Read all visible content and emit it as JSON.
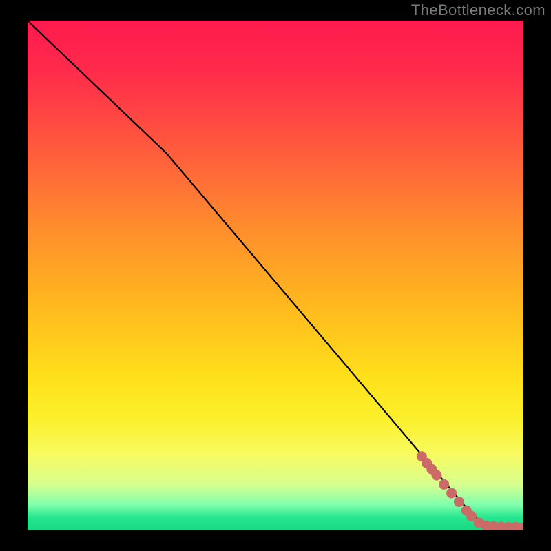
{
  "watermark": "TheBottleneck.com",
  "chart_data": {
    "type": "line",
    "title": "",
    "xlabel": "",
    "ylabel": "",
    "xlim": [
      0,
      100
    ],
    "ylim": [
      0,
      100
    ],
    "line": {
      "x": [
        0,
        28,
        88,
        92,
        100
      ],
      "y": [
        100,
        74,
        5,
        1,
        0.5
      ]
    },
    "markers": {
      "x": [
        79.5,
        80.5,
        81.5,
        82.5,
        84,
        85.5,
        87,
        88.5,
        89.5,
        91,
        92.5,
        94,
        95.5,
        97,
        98.5,
        100
      ],
      "y": [
        14.5,
        13.2,
        12.0,
        10.8,
        9.0,
        7.3,
        5.6,
        3.9,
        2.8,
        1.5,
        0.9,
        0.8,
        0.7,
        0.6,
        0.6,
        0.5
      ]
    },
    "background_gradient": {
      "type": "vertical",
      "stops": [
        {
          "pos": 0.0,
          "color": "#ff1a4d"
        },
        {
          "pos": 0.1,
          "color": "#ff2b4b"
        },
        {
          "pos": 0.25,
          "color": "#ff5a3d"
        },
        {
          "pos": 0.4,
          "color": "#ff8b2e"
        },
        {
          "pos": 0.55,
          "color": "#ffb61f"
        },
        {
          "pos": 0.7,
          "color": "#ffe01a"
        },
        {
          "pos": 0.78,
          "color": "#fbf02a"
        },
        {
          "pos": 0.85,
          "color": "#f8fa60"
        },
        {
          "pos": 0.91,
          "color": "#d7ff8f"
        },
        {
          "pos": 0.95,
          "color": "#80ffad"
        },
        {
          "pos": 0.975,
          "color": "#25e68e"
        },
        {
          "pos": 1.0,
          "color": "#19d885"
        }
      ]
    },
    "marker_color": "#cb6b68",
    "line_color": "#000000"
  }
}
